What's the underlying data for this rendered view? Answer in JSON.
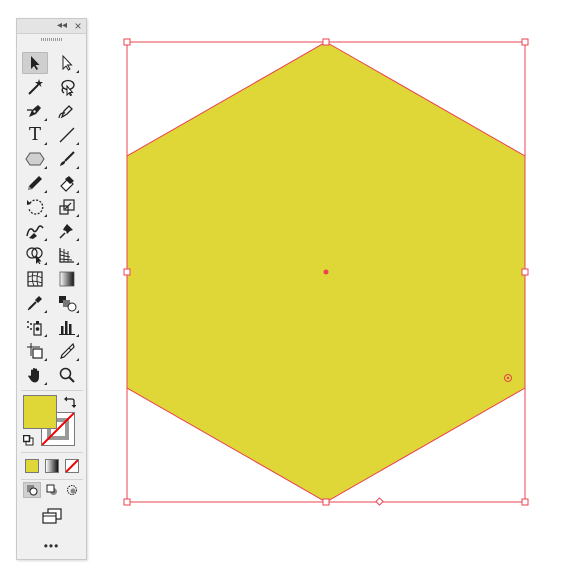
{
  "panel": {
    "collapse_label": "◂◂",
    "close_label": "×",
    "more_label": "•••"
  },
  "tools": [
    {
      "name": "selection-tool",
      "active": true
    },
    {
      "name": "direct-selection-tool"
    },
    {
      "name": "magic-wand-tool"
    },
    {
      "name": "lasso-tool"
    },
    {
      "name": "pen-tool"
    },
    {
      "name": "curvature-tool"
    },
    {
      "name": "type-tool",
      "glyph": "T"
    },
    {
      "name": "line-segment-tool"
    },
    {
      "name": "polygon-tool"
    },
    {
      "name": "paintbrush-tool"
    },
    {
      "name": "pencil-tool"
    },
    {
      "name": "eraser-tool"
    },
    {
      "name": "rotate-tool"
    },
    {
      "name": "scale-tool"
    },
    {
      "name": "warp-tool"
    },
    {
      "name": "puppet-warp-tool"
    },
    {
      "name": "shape-builder-tool"
    },
    {
      "name": "perspective-grid-tool"
    },
    {
      "name": "mesh-tool"
    },
    {
      "name": "gradient-tool"
    },
    {
      "name": "eyedropper-tool"
    },
    {
      "name": "blend-tool"
    },
    {
      "name": "symbol-sprayer-tool"
    },
    {
      "name": "column-graph-tool"
    },
    {
      "name": "artboard-tool"
    },
    {
      "name": "slice-tool"
    },
    {
      "name": "hand-tool"
    },
    {
      "name": "zoom-tool"
    }
  ],
  "colors": {
    "fill": "#dfd638",
    "stroke": "none",
    "selection": "#e8434f",
    "panel_bg": "#f0f0f0"
  },
  "canvas": {
    "shape": "hexagon",
    "fill_color": "#dfd638",
    "outline_color": "#e8434f",
    "selected": true
  }
}
